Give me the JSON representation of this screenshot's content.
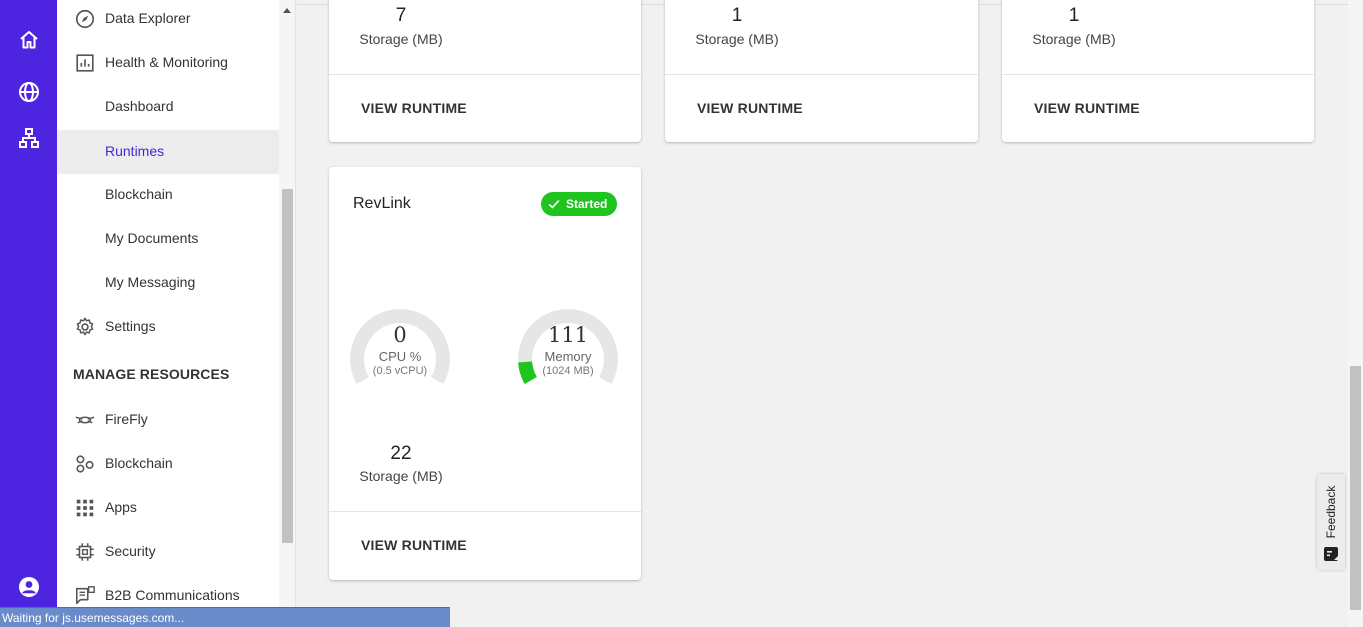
{
  "rail": {
    "items": [
      "home-icon",
      "globe-icon",
      "network-icon",
      "account-icon"
    ]
  },
  "nav": {
    "items": [
      {
        "label": "Data Explorer",
        "icon": "compass-icon"
      },
      {
        "label": "Health & Monitoring",
        "icon": "chart-box-icon"
      },
      {
        "label": "Dashboard",
        "icon": ""
      },
      {
        "label": "Runtimes",
        "icon": "",
        "active": true
      },
      {
        "label": "Blockchain",
        "icon": ""
      },
      {
        "label": "My Documents",
        "icon": ""
      },
      {
        "label": "My Messaging",
        "icon": ""
      },
      {
        "label": "Settings",
        "icon": "gear-icon"
      }
    ],
    "manage_heading": "MANAGE RESOURCES",
    "manage_items": [
      {
        "label": "FireFly",
        "icon": "firefly-icon"
      },
      {
        "label": "Blockchain",
        "icon": "blockchain-icon"
      },
      {
        "label": "Apps",
        "icon": "apps-grid-icon"
      },
      {
        "label": "Security",
        "icon": "chip-icon"
      },
      {
        "label": "B2B Communications",
        "icon": "b2b-icon"
      }
    ]
  },
  "top_cards": [
    {
      "storage_value": "7",
      "storage_label": "Storage (MB)",
      "button": "VIEW RUNTIME"
    },
    {
      "storage_value": "1",
      "storage_label": "Storage (MB)",
      "button": "VIEW RUNTIME"
    },
    {
      "storage_value": "1",
      "storage_label": "Storage (MB)",
      "button": "VIEW RUNTIME"
    }
  ],
  "runtime_card": {
    "title": "RevLink",
    "status": "Started",
    "status_color": "#1fc41f",
    "cpu": {
      "value": "0",
      "label": "CPU %",
      "sub": "(0.5 vCPU)",
      "fraction": 0.0
    },
    "memory": {
      "value": "111",
      "label": "Memory",
      "sub": "(1024 MB)",
      "fraction": 0.108
    },
    "storage_value": "22",
    "storage_label": "Storage (MB)",
    "button": "VIEW RUNTIME"
  },
  "feedback": {
    "label": "Feedback"
  },
  "statusbar": {
    "text": "Waiting for js.usemessages.com..."
  },
  "colors": {
    "rail": "#4d25e0",
    "accent": "#4a25d8",
    "gauge_fill": "#1fc41f"
  }
}
